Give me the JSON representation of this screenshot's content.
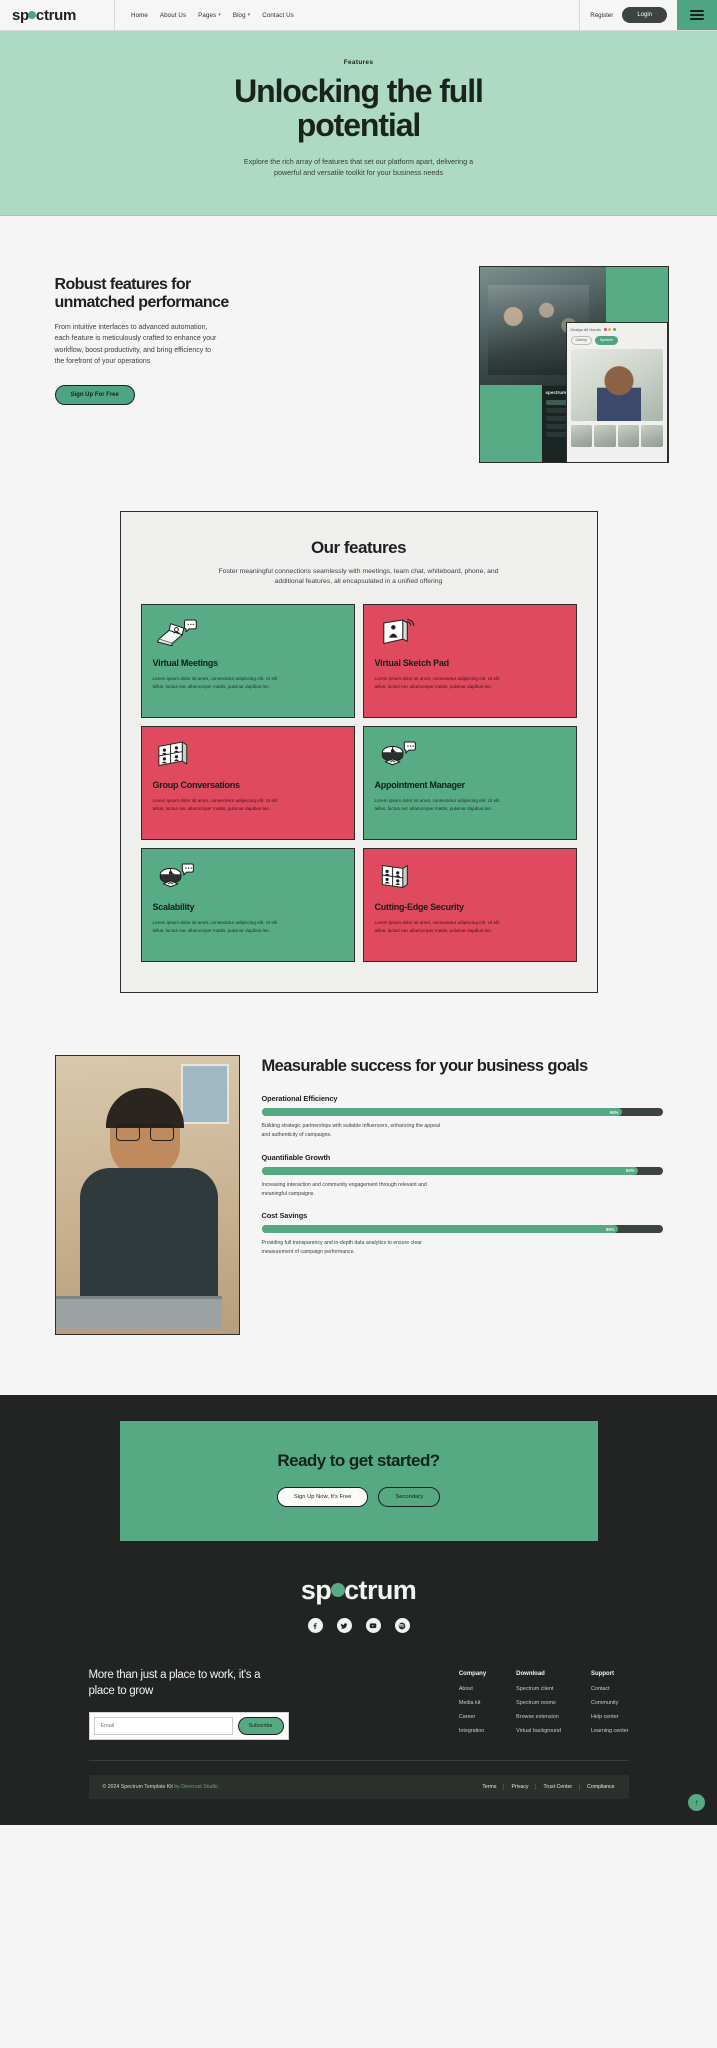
{
  "brand": {
    "name": "sp ctrum",
    "name_before": "sp",
    "name_after": "ctrum",
    "accent": "#4ea583",
    "red": "#e04a5f",
    "dark": "#212422"
  },
  "navbar": {
    "links": [
      {
        "label": "Home",
        "caret": false
      },
      {
        "label": "About Us",
        "caret": false
      },
      {
        "label": "Pages",
        "caret": true
      },
      {
        "label": "Blog",
        "caret": true
      },
      {
        "label": "Contact Us",
        "caret": false
      }
    ],
    "register_label": "Register",
    "login_label": "Login"
  },
  "hero": {
    "eyebrow": "Features",
    "title": "Unlocking the full potential",
    "subtitle": "Explore the rich array of features that set our platform apart, delivering a powerful and versatile toolkit for your business needs"
  },
  "robust": {
    "title": "Robust features for unmatched performance",
    "body": "From intuitive interfaces to advanced automation, each feature is meticulously crafted to enhance your workflow, boost productivity, and bring efficiency to the forefront of your operations",
    "cta_label": "Sign Up For Free",
    "collage": {
      "app_logo": "spectrum",
      "panel_title": "Design All Hands",
      "chips": [
        "Gallery",
        "Speaker"
      ]
    }
  },
  "features": {
    "title": "Our features",
    "subtitle": "Foster meaningful connections seamlessly with meetings, team chat, whiteboard, phone, and additional features, all encapsulated in a unified offering",
    "body_text": "Lorem ipsum dolor sit amet, consectetur adipiscing elit. Ut elit tellus, luctus nec ullamcorper mattis, pulvinar dapibus leo.",
    "cards": [
      {
        "title": "Virtual Meetings",
        "color": "green",
        "icon": "laptop-chat-icon"
      },
      {
        "title": "Virtual Sketch Pad",
        "color": "red",
        "icon": "sketch-board-icon"
      },
      {
        "title": "Group Conversations",
        "color": "red",
        "icon": "grid-people-icon"
      },
      {
        "title": "Appointment Manager",
        "color": "green",
        "icon": "clock-chat-icon"
      },
      {
        "title": "Scalability",
        "color": "green",
        "icon": "clock-chat-icon"
      },
      {
        "title": "Cutting-Edge Security",
        "color": "red",
        "icon": "grid-people-icon"
      }
    ]
  },
  "measurable": {
    "title": "Measurable success for your business goals",
    "metrics": [
      {
        "label": "Operational Efficiency",
        "percent": "90%",
        "value": 90,
        "description": "Building strategic partnerships with suitable influencers, enhancing the appeal and authenticity of campaigns."
      },
      {
        "label": "Quantifiable Growth",
        "percent": "94%",
        "value": 94,
        "description": "Increasing interaction and community engagement through relevant and meaningful campaigns."
      },
      {
        "label": "Cost Savings",
        "percent": "89%",
        "value": 89,
        "description": "Providing full transparency and in-depth data analytics to ensure clear measurement of campaign performance."
      }
    ]
  },
  "cta": {
    "title": "Ready to get started?",
    "primary_label": "Sign Up Now, It's Free",
    "secondary_label": "Secondary"
  },
  "footer": {
    "socials": [
      "facebook-icon",
      "twitter-icon",
      "youtube-icon",
      "spotify-icon"
    ],
    "headline": "More than just a place to work, it's a place to grow",
    "email_placeholder": "Email",
    "subscribe_label": "Subscribe",
    "columns": [
      {
        "title": "Company",
        "links": [
          "About",
          "Media kit",
          "Career",
          "Integration"
        ]
      },
      {
        "title": "Download",
        "links": [
          "Spectrum client",
          "Spectrum rooms",
          "Browse extension",
          "Virtual background"
        ]
      },
      {
        "title": "Support",
        "links": [
          "Contact",
          "Community",
          "Help center",
          "Learning center"
        ]
      }
    ],
    "copyright": "© 2024 Spectrum Template Kit",
    "by": "by Devcrust Studio",
    "legal": [
      "Terms",
      "Privacy",
      "Trust Center",
      "Compliance"
    ],
    "scroll_top_icon": "arrow-up-icon"
  }
}
